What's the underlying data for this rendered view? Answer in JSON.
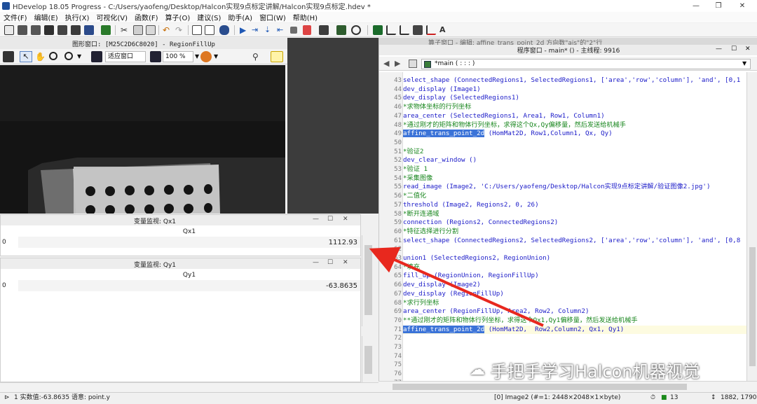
{
  "window": {
    "title": "HDevelop 18.05 Progress - C:/Users/yaofeng/Desktop/Halcon实现9点标定讲解/Halcon实现9点标定.hdev *",
    "minimize": "—",
    "maximize": "❐",
    "close": "✕"
  },
  "menu": [
    "文件(F)",
    "编辑(E)",
    "执行(X)",
    "可视化(V)",
    "函数(F)",
    "算子(O)",
    "建议(S)",
    "助手(A)",
    "窗口(W)",
    "帮助(H)"
  ],
  "graphics": {
    "title": "图形窗口: [M25C2D6C8020] - RegionFillUp",
    "zoom_mode": "适应窗口",
    "zoom_percent": "100 %"
  },
  "inspect_qx": {
    "title": "变量监视: Qx1",
    "column": "Qx1",
    "index": "0",
    "value": "1112.93"
  },
  "inspect_qy": {
    "title": "变量监视: Qy1",
    "column": "Qy1",
    "index": "0",
    "value": "-63.8635"
  },
  "program": {
    "overlay_text": "算子窗口 - 编辑: affine_trans_point_2d 方向数\"ais\"的\"2\"行",
    "title": "程序窗口 - main* () - 主线程: 9916",
    "procedure": "*main ( : : : )",
    "lines": [
      {
        "n": "43",
        "t": "select_shape (ConnectedRegions1, SelectedRegions1, ['area','row','column'], 'and', [0,1"
      },
      {
        "n": "44",
        "t": "dev_display (Image1)"
      },
      {
        "n": "45",
        "t": "dev_display (SelectedRegions1)"
      },
      {
        "n": "46",
        "t": "*求物体坐标的行列坐标"
      },
      {
        "n": "47",
        "t": "area_center (SelectedRegions1, Area1, Row1, Column1)"
      },
      {
        "n": "48",
        "t": "*通过刚才的矩阵和物体行列坐标，求得这个Qx,Qy偏移量，然后发送给机械手"
      },
      {
        "n": "49",
        "t": "affine_trans_point_2d (HomMat2D, Row1,Column1, Qx, Qy)"
      },
      {
        "n": "50",
        "t": ""
      },
      {
        "n": "51",
        "t": "*验证2"
      },
      {
        "n": "52",
        "t": "dev_clear_window ()"
      },
      {
        "n": "53",
        "t": "*验证 1"
      },
      {
        "n": "54",
        "t": "*采集图像"
      },
      {
        "n": "55",
        "t": "read_image (Image2, 'C:/Users/yaofeng/Desktop/Halcon实现9点标定讲解/验证图像2.jpg')"
      },
      {
        "n": "56",
        "t": "*二值化"
      },
      {
        "n": "57",
        "t": "threshold (Image2, Regions2, 0, 26)"
      },
      {
        "n": "58",
        "t": "*断开连通域"
      },
      {
        "n": "59",
        "t": "connection (Regions2, ConnectedRegions2)"
      },
      {
        "n": "60",
        "t": "*特征选择进行分割"
      },
      {
        "n": "61",
        "t": "select_shape (ConnectedRegions2, SelectedRegions2, ['area','row','column'], 'and', [0,8"
      },
      {
        "n": "62",
        "t": ""
      },
      {
        "n": "63",
        "t": "union1 (SelectedRegions2, RegionUnion)"
      },
      {
        "n": "64",
        "t": "*填充"
      },
      {
        "n": "65",
        "t": "fill_up (RegionUnion, RegionFillUp)"
      },
      {
        "n": "66",
        "t": "dev_display (Image2)"
      },
      {
        "n": "67",
        "t": "dev_display (RegionFillUp)"
      },
      {
        "n": "68",
        "t": "*求行列坐标"
      },
      {
        "n": "69",
        "t": "area_center (RegionFillUp, Area2, Row2, Column2)"
      },
      {
        "n": "70",
        "t": "**通过刚才的矩阵和物体行列坐标，求得这个Qx1,Qy1偏移量，然后发送给机械手"
      },
      {
        "n": "71",
        "t": "affine_trans_point_2d (HomMat2D,  Row2,Column2, Qx1, Qy1)"
      },
      {
        "n": "72",
        "t": ""
      },
      {
        "n": "73",
        "t": ""
      },
      {
        "n": "74",
        "t": ""
      },
      {
        "n": "75",
        "t": ""
      },
      {
        "n": "76",
        "t": ""
      },
      {
        "n": "77",
        "t": ""
      }
    ]
  },
  "status": {
    "left": "1 实数值:-63.8635 语意: point.y",
    "image_info": "[0] Image2 (#=1: 2448×2048×1×byte)",
    "count": "13",
    "coords": "1882, 1790"
  },
  "watermark": "手把手学习Halcon机器视觉",
  "colors": {
    "operator": "#1a1ac8",
    "comment": "#18861d",
    "selection": "#3b73d8",
    "arrow": "#e8281e",
    "blob": "#ff1a1a"
  }
}
